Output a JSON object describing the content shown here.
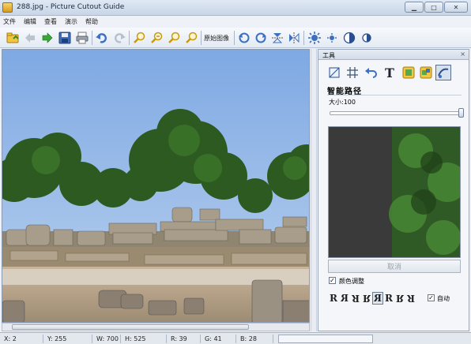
{
  "window": {
    "title": "288.jpg - Picture Cutout Guide"
  },
  "menu": [
    "文件",
    "编辑",
    "查看",
    "演示",
    "帮助"
  ],
  "toolbar": {
    "original_label": "原始图像",
    "icons": [
      "open-icon",
      "back-icon",
      "forward-icon",
      "save-icon",
      "print-icon",
      "undo-icon",
      "redo-icon",
      "zoom-in-icon",
      "zoom-out-icon",
      "zoom-fit-icon",
      "zoom-actual-icon",
      "rotate-left-icon",
      "rotate-right-icon",
      "flip-vertical-icon",
      "flip-horizontal-icon",
      "brightness-icon",
      "settings-small-icon",
      "contrast-icon",
      "contrast-small-icon"
    ]
  },
  "panel": {
    "title": "工具",
    "close": "×",
    "mode_title": "智能路径",
    "size_label": "大小:100",
    "size_value": 100,
    "cancel_label": "取消",
    "color_adjust_label": "颜色调整",
    "color_adjust_checked": true,
    "auto_label": "自动",
    "auto_checked": true,
    "r_glyphs": [
      "R",
      "R",
      "R",
      "R",
      "R",
      "R",
      "R",
      "R"
    ],
    "active_r_index": 4,
    "tools": [
      "crop-icon",
      "grid-icon",
      "undo-arrow-icon",
      "text-icon",
      "layer-add-icon",
      "layer-replace-icon",
      "magic-path-icon"
    ]
  },
  "status": {
    "x": "X: 2",
    "y": "Y: 255",
    "w": "W: 700",
    "h": "H: 525",
    "r": "R: 39",
    "g": "G: 41",
    "b": "B: 28"
  },
  "colors": {
    "accent": "#2f6fb3",
    "sky": "#9bbfe8",
    "tree": "#2f5a25"
  }
}
